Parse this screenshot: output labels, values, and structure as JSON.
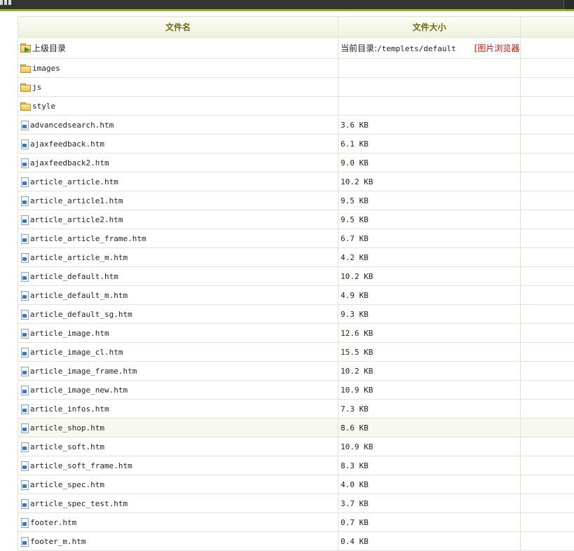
{
  "table": {
    "headers": {
      "name": "文件名",
      "size": "文件大小"
    },
    "parent": {
      "label": "上级目录",
      "current_dir_label": "当前目录:",
      "current_dir": "/templets/default",
      "image_browser": "[图片浏览器]"
    },
    "folders": [
      {
        "name": "images"
      },
      {
        "name": "js"
      },
      {
        "name": "style"
      }
    ],
    "files": [
      {
        "name": "advancedsearch.htm",
        "size": "3.6 KB"
      },
      {
        "name": "ajaxfeedback.htm",
        "size": "6.1 KB"
      },
      {
        "name": "ajaxfeedback2.htm",
        "size": "9.0 KB"
      },
      {
        "name": "article_article.htm",
        "size": "10.2 KB"
      },
      {
        "name": "article_article1.htm",
        "size": "9.5 KB"
      },
      {
        "name": "article_article2.htm",
        "size": "9.5 KB"
      },
      {
        "name": "article_article_frame.htm",
        "size": "6.7 KB"
      },
      {
        "name": "article_article_m.htm",
        "size": "4.2 KB"
      },
      {
        "name": "article_default.htm",
        "size": "10.2 KB"
      },
      {
        "name": "article_default_m.htm",
        "size": "4.9 KB"
      },
      {
        "name": "article_default_sg.htm",
        "size": "9.3 KB"
      },
      {
        "name": "article_image.htm",
        "size": "12.6 KB"
      },
      {
        "name": "article_image_cl.htm",
        "size": "15.5 KB"
      },
      {
        "name": "article_image_frame.htm",
        "size": "10.2 KB"
      },
      {
        "name": "article_image_new.htm",
        "size": "10.9 KB"
      },
      {
        "name": "article_infos.htm",
        "size": "7.3 KB"
      },
      {
        "name": "article_shop.htm",
        "size": "8.6 KB"
      },
      {
        "name": "article_soft.htm",
        "size": "10.9 KB"
      },
      {
        "name": "article_soft_frame.htm",
        "size": "8.3 KB"
      },
      {
        "name": "article_spec.htm",
        "size": "4.0 KB"
      },
      {
        "name": "article_spec_test.htm",
        "size": "3.7 KB"
      },
      {
        "name": "footer.htm",
        "size": "0.7 KB"
      },
      {
        "name": "footer_m.htm",
        "size": "0.4 KB"
      }
    ]
  },
  "colors": {
    "header_text": "#6d6a16",
    "accent_line": "#8fb02a",
    "link_red": "#c2140c",
    "topbar": "#343434"
  },
  "icons": {
    "parent": "folder-up-icon",
    "folder": "folder-icon",
    "file": "htm-file-icon"
  }
}
